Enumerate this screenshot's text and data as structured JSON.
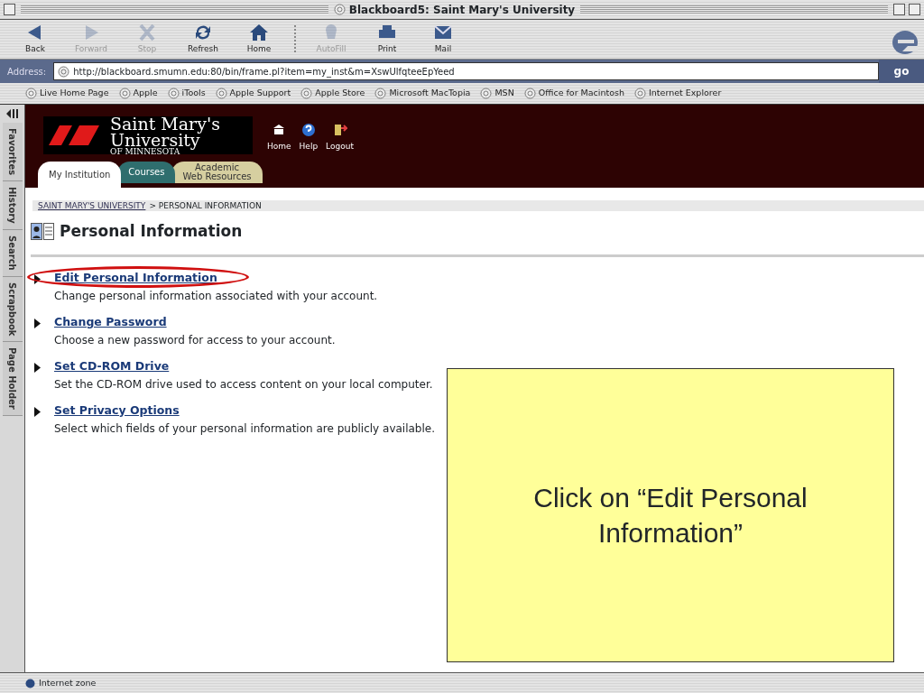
{
  "window": {
    "title": "Blackboard5: Saint Mary's University"
  },
  "toolbar": [
    {
      "label": "Back",
      "disabled": false
    },
    {
      "label": "Forward",
      "disabled": true
    },
    {
      "label": "Stop",
      "disabled": true
    },
    {
      "label": "Refresh",
      "disabled": false
    },
    {
      "label": "Home",
      "disabled": false
    },
    {
      "label": "AutoFill",
      "disabled": true
    },
    {
      "label": "Print",
      "disabled": false
    },
    {
      "label": "Mail",
      "disabled": false
    }
  ],
  "address_bar": {
    "label": "Address:",
    "value": "http://blackboard.smumn.edu:80/bin/frame.pl?item=my_inst&m=XswUlfqteeEpYeed",
    "go": "go"
  },
  "favorites_bar": [
    "Live Home Page",
    "Apple",
    "iTools",
    "Apple Support",
    "Apple Store",
    "Microsoft MacTopia",
    "MSN",
    "Office for Macintosh",
    "Internet Explorer"
  ],
  "explorer_tabs": [
    "Favorites",
    "History",
    "Search",
    "Scrapbook",
    "Page Holder"
  ],
  "site_header": {
    "logo_lines": [
      "Saint Mary's",
      "University",
      "OF MINNESOTA"
    ],
    "links": [
      "Home",
      "Help",
      "Logout"
    ]
  },
  "portal_tabs": [
    {
      "lines": [
        "My Institution"
      ],
      "selected": true,
      "color": "#ffffff"
    },
    {
      "lines": [
        "Courses"
      ],
      "selected": false,
      "color": "#2f6e6e"
    },
    {
      "lines": [
        "Academic",
        "Web Resources"
      ],
      "selected": false,
      "color": "#d6cfa0"
    }
  ],
  "breadcrumb": {
    "link": "SAINT MARY'S UNIVERSITY",
    "rest": "> PERSONAL INFORMATION"
  },
  "page_title": "Personal Information",
  "options": [
    {
      "title": "Edit Personal Information",
      "description": "Change personal information associated with your account.",
      "highlighted": true
    },
    {
      "title": "Change Password",
      "description": "Choose a new password for access to your account.",
      "highlighted": false
    },
    {
      "title": "Set CD-ROM Drive",
      "description": "Set the CD-ROM drive used to access content on your local computer.",
      "highlighted": false
    },
    {
      "title": "Set Privacy Options",
      "description": "Select which fields of your personal information are publicly available.",
      "highlighted": false
    }
  ],
  "status_bar": "Internet zone",
  "callout": "Click on “Edit Personal Information”"
}
